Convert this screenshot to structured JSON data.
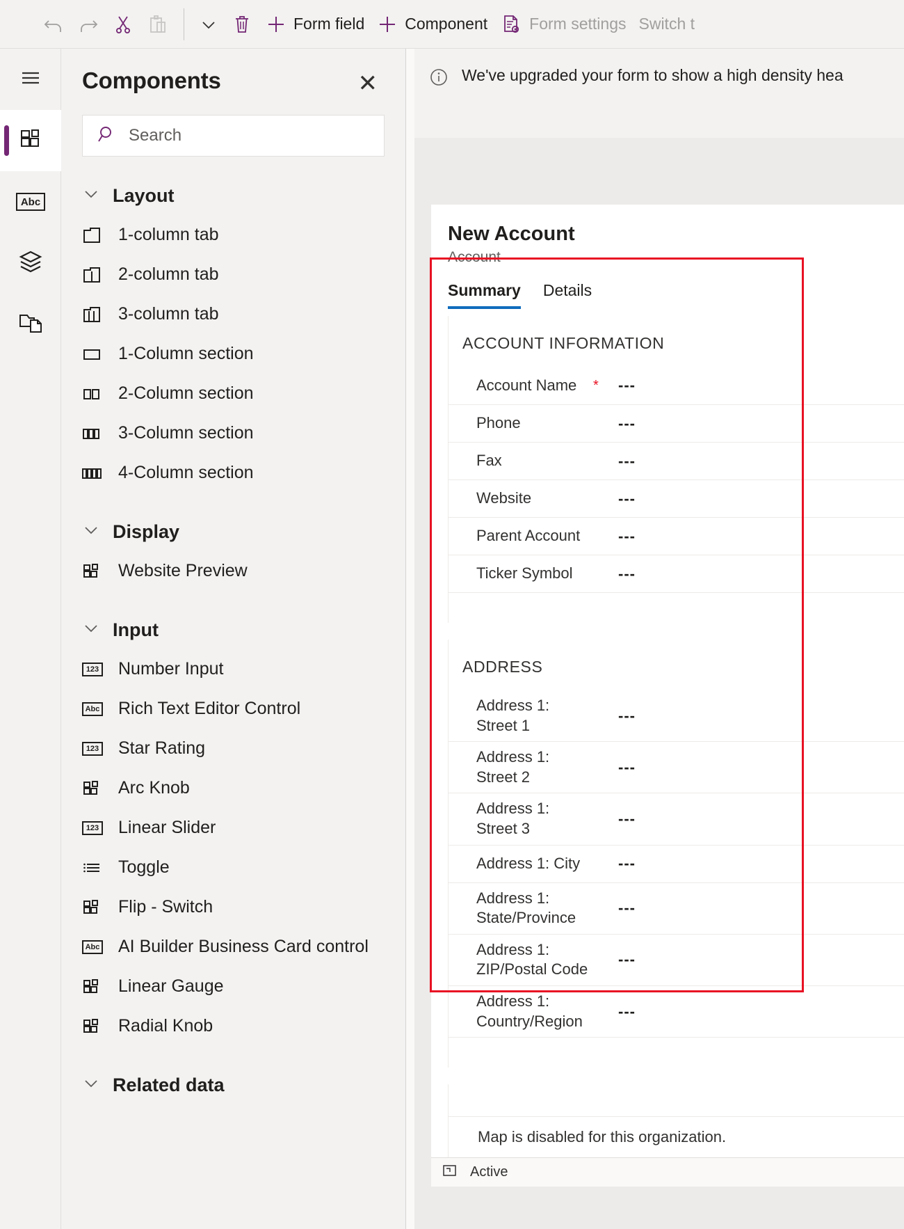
{
  "toolbar": {
    "items": [
      {
        "label": "",
        "icon": "undo-icon",
        "disabled": true
      },
      {
        "label": "",
        "icon": "redo-icon",
        "disabled": true
      },
      {
        "label": "",
        "icon": "cut-icon",
        "disabled": false
      },
      {
        "label": "",
        "icon": "paste-icon",
        "disabled": true
      },
      {
        "label": "",
        "icon": "chevron-down-icon",
        "disabled": false
      },
      {
        "label": "",
        "icon": "delete-icon",
        "disabled": false
      },
      {
        "label": "Form field",
        "icon": "plus-icon",
        "disabled": false
      },
      {
        "label": "Component",
        "icon": "plus-icon",
        "disabled": false
      },
      {
        "label": "Form settings",
        "icon": "form-settings-icon",
        "disabled": true
      },
      {
        "label": "Switch t",
        "icon": "none",
        "disabled": true
      }
    ],
    "accent_color": "#742774",
    "disabled_color": "#a19f9d"
  },
  "rail": {
    "items": [
      {
        "name": "menu",
        "icon": "hamburger-icon",
        "active": false
      },
      {
        "name": "components",
        "icon": "components-icon",
        "active": true
      },
      {
        "name": "table-columns",
        "icon": "abc-icon",
        "active": false
      },
      {
        "name": "tree-view",
        "icon": "layers-icon",
        "active": false
      },
      {
        "name": "related",
        "icon": "copy-folder-icon",
        "active": false
      }
    ]
  },
  "panel": {
    "title": "Components",
    "close_label": "✕",
    "search": {
      "placeholder": "Search",
      "value": "",
      "icon": "search-icon"
    },
    "groups": [
      {
        "name": "Layout",
        "expanded": true,
        "items": [
          {
            "label": "1-column tab",
            "icon": "tab-1col-icon"
          },
          {
            "label": "2-column tab",
            "icon": "tab-2col-icon"
          },
          {
            "label": "3-column tab",
            "icon": "tab-3col-icon"
          },
          {
            "label": "1-Column section",
            "icon": "section-1col-icon"
          },
          {
            "label": "2-Column section",
            "icon": "section-2col-icon"
          },
          {
            "label": "3-Column section",
            "icon": "section-3col-icon"
          },
          {
            "label": "4-Column section",
            "icon": "section-4col-icon"
          }
        ]
      },
      {
        "name": "Display",
        "expanded": true,
        "items": [
          {
            "label": "Website Preview",
            "icon": "component-icon"
          }
        ]
      },
      {
        "name": "Input",
        "expanded": true,
        "items": [
          {
            "label": "Number Input",
            "icon": "number-icon"
          },
          {
            "label": "Rich Text Editor Control",
            "icon": "abc-icon"
          },
          {
            "label": "Star Rating",
            "icon": "number-icon"
          },
          {
            "label": "Arc Knob",
            "icon": "component-icon"
          },
          {
            "label": "Linear Slider",
            "icon": "number-icon"
          },
          {
            "label": "Toggle",
            "icon": "list-icon"
          },
          {
            "label": "Flip - Switch",
            "icon": "component-icon"
          },
          {
            "label": "AI Builder Business Card control",
            "icon": "abc-icon"
          },
          {
            "label": "Linear Gauge",
            "icon": "component-icon"
          },
          {
            "label": "Radial Knob",
            "icon": "component-icon"
          }
        ]
      },
      {
        "name": "Related data",
        "expanded": true,
        "items": []
      }
    ]
  },
  "canvas": {
    "notification": {
      "icon": "info-icon",
      "text": "We've upgraded your form to show a high density hea"
    },
    "form": {
      "title": "New Account",
      "subtitle": "Account",
      "tabs": [
        {
          "label": "Summary",
          "selected": true
        },
        {
          "label": "Details",
          "selected": false
        }
      ],
      "tab_accent": "#0f6cbd",
      "selection_color": "#e81123",
      "sections": [
        {
          "title": "ACCOUNT INFORMATION",
          "rows": [
            {
              "label": "Account Name",
              "required": true,
              "value": "---"
            },
            {
              "label": "Phone",
              "required": false,
              "value": "---"
            },
            {
              "label": "Fax",
              "required": false,
              "value": "---"
            },
            {
              "label": "Website",
              "required": false,
              "value": "---"
            },
            {
              "label": "Parent Account",
              "required": false,
              "value": "---"
            },
            {
              "label": "Ticker Symbol",
              "required": false,
              "value": "---"
            }
          ]
        },
        {
          "title": "ADDRESS",
          "rows": [
            {
              "label": "Address 1: Street 1",
              "required": false,
              "value": "---"
            },
            {
              "label": "Address 1: Street 2",
              "required": false,
              "value": "---"
            },
            {
              "label": "Address 1: Street 3",
              "required": false,
              "value": "---"
            },
            {
              "label": "Address 1: City",
              "required": false,
              "value": "---"
            },
            {
              "label": "Address 1: State/Province",
              "required": false,
              "value": "---"
            },
            {
              "label": "Address 1: ZIP/Postal Code",
              "required": false,
              "value": "---"
            },
            {
              "label": "Address 1: Country/Region",
              "required": false,
              "value": "---"
            }
          ]
        }
      ],
      "map_message": "Map is disabled for this organization.",
      "status": {
        "icon": "expand-icon",
        "label": "Active"
      }
    }
  }
}
